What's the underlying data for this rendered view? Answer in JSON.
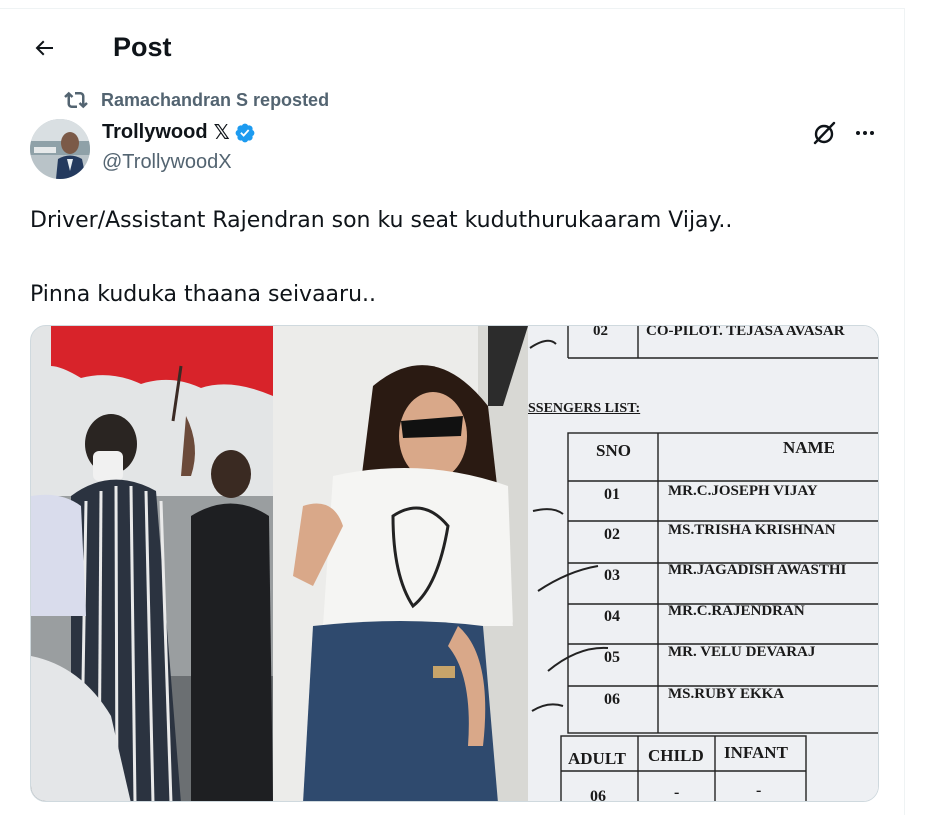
{
  "header": {
    "title": "Post"
  },
  "repost": {
    "text": "Ramachandran S reposted"
  },
  "author": {
    "name": "Trollywood",
    "x_mark": "𝕏",
    "handle": "@TrollywoodX"
  },
  "tweet": {
    "text": "Driver/Assistant Rajendran son ku seat kuduthurukaaram Vijay..\n\nPinna kuduka thaana seivaaru.."
  },
  "media": {
    "document": {
      "row_prev_no": "02",
      "row_prev_text": "CO-PILOT. TEJASA AVASAR",
      "list_title": "SSENGERS LIST:",
      "col_sno": "SNO",
      "col_name": "NAME",
      "rows": [
        {
          "sno": "01",
          "name": "MR.C.JOSEPH VIJAY"
        },
        {
          "sno": "02",
          "name": "MS.TRISHA KRISHNAN"
        },
        {
          "sno": "03",
          "name": "MR.JAGADISH AWASTHI"
        },
        {
          "sno": "04",
          "name": "MR.C.RAJENDRAN"
        },
        {
          "sno": "05",
          "name": "MR. VELU DEVARAJ"
        },
        {
          "sno": "06",
          "name": "MS.RUBY EKKA"
        }
      ],
      "summary_headers": [
        "ADULT",
        "CHILD",
        "INFANT"
      ],
      "summary_values": [
        "06",
        "-",
        "-"
      ]
    }
  },
  "colors": {
    "text_primary": "#0f1419",
    "text_secondary": "#536471",
    "verified_blue": "#1d9bf0",
    "border": "#cfd9de"
  }
}
